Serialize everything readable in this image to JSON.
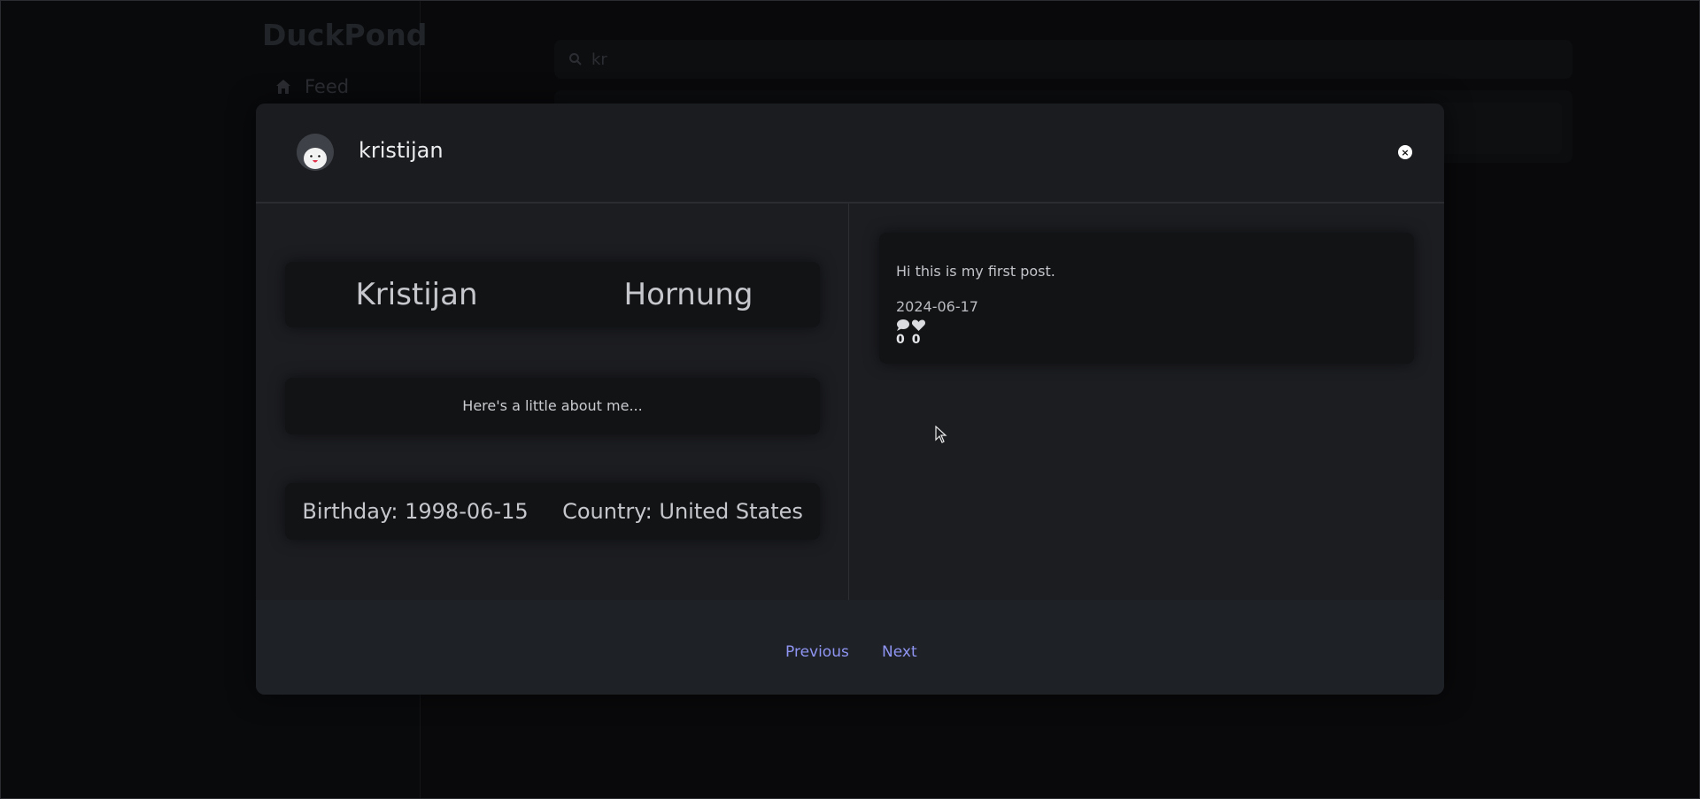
{
  "background": {
    "brand": "DuckPond",
    "nav": {
      "feed_label": "Feed"
    },
    "search": {
      "value": "kr"
    }
  },
  "modal": {
    "username": "kristijan",
    "close_label": "×",
    "profile": {
      "first_name": "Kristijan",
      "last_name": "Hornung",
      "bio": "Here's a little about me...",
      "birthday": "Birthday: 1998-06-15",
      "country": "Country: United States"
    },
    "posts": [
      {
        "text": "Hi this is my first post.",
        "date": "2024-06-17",
        "comments": "0",
        "likes": "0"
      }
    ],
    "pagination": {
      "previous": "Previous",
      "next": "Next"
    }
  },
  "colors": {
    "accent": "#8f95f2",
    "modal_bg": "#1a1b1f",
    "card_bg": "#121315"
  },
  "icons": [
    "home-icon",
    "search-icon",
    "avatar-penguin-icon",
    "close-icon",
    "comment-icon",
    "heart-icon",
    "cursor-icon"
  ]
}
